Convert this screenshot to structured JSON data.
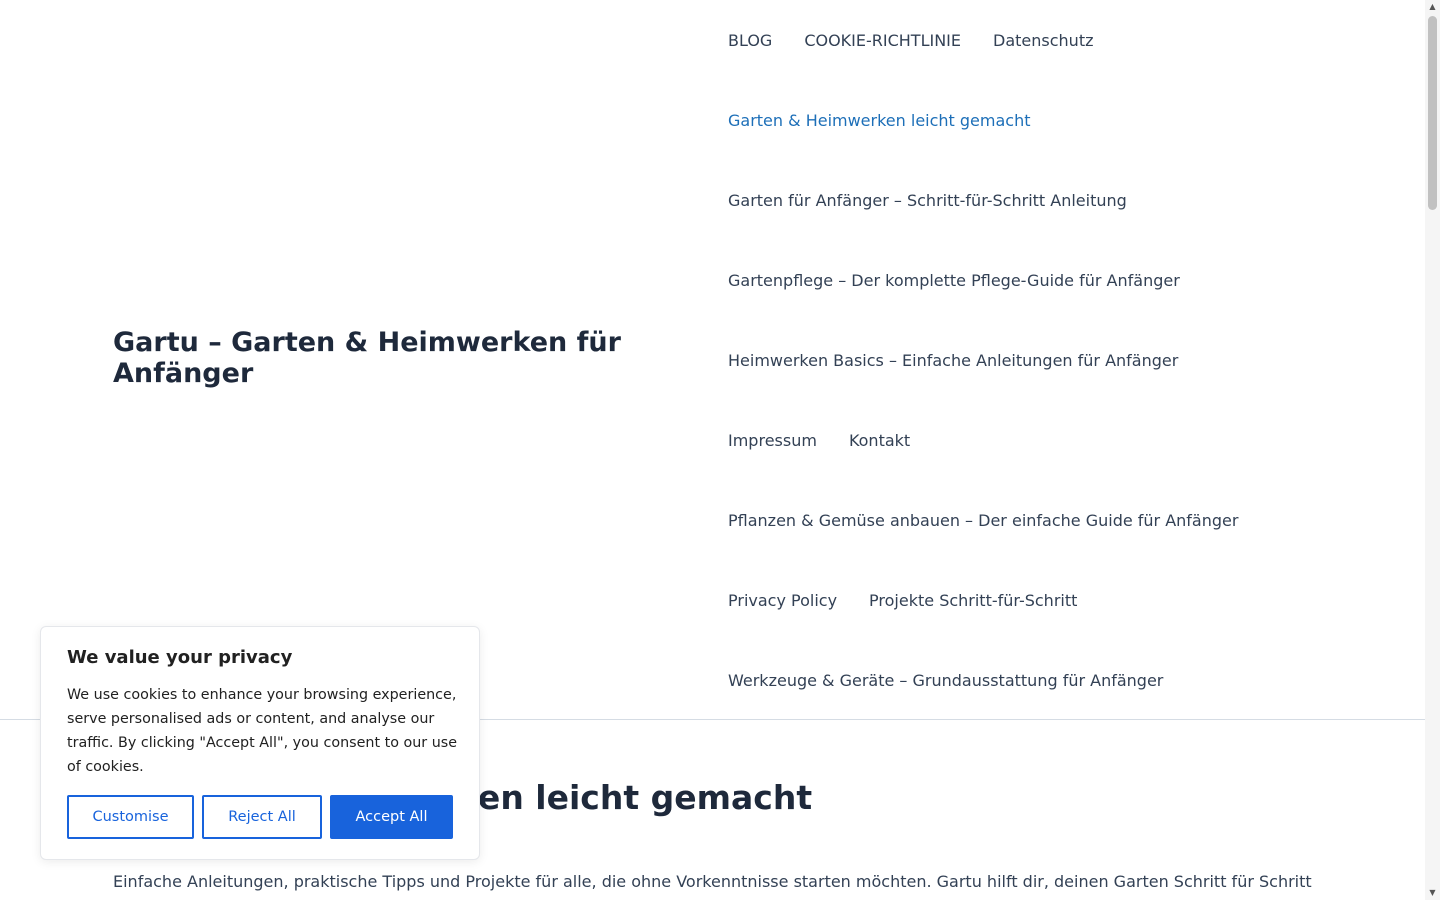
{
  "site": {
    "title": "Gartu – Garten & Heimwerken für Anfänger"
  },
  "nav": {
    "rows": [
      [
        "BLOG",
        "COOKIE-RICHTLINIE",
        "Datenschutz"
      ],
      [
        "Garten & Heimwerken leicht gemacht"
      ],
      [
        "Garten für Anfänger – Schritt-für-Schritt Anleitung"
      ],
      [
        "Gartenpflege – Der komplette Pflege-Guide für Anfänger"
      ],
      [
        "Heimwerken Basics – Einfache Anleitungen für Anfänger"
      ],
      [
        "Impressum",
        "Kontakt"
      ],
      [
        "Pflanzen & Gemüse anbauen – Der einfache Guide für Anfänger"
      ],
      [
        "Privacy Policy",
        "Projekte Schritt-für-Schritt"
      ],
      [
        "Werkzeuge & Geräte – Grundausstattung für Anfänger"
      ]
    ],
    "current_item": "Garten & Heimwerken leicht gemacht",
    "current_color": "#1d6fb8"
  },
  "main": {
    "heading": "Garten & Heimwerken leicht gemacht",
    "intro": "Einfache Anleitungen, praktische Tipps und Projekte für alle, die ohne Vorkenntnisse starten möchten. Gartu hilft dir, deinen Garten Schritt für Schritt"
  },
  "cookie": {
    "title": "We value your privacy",
    "text": "We use cookies to enhance your browsing experience, serve personalised ads or content, and analyse our traffic. By clicking \"Accept All\", you consent to our use of cookies.",
    "customise_label": "Customise",
    "reject_label": "Reject All",
    "accept_label": "Accept All",
    "accent_color": "#1863dc"
  },
  "scrollbar": {
    "up_icon": "▲",
    "down_icon": "▼"
  }
}
